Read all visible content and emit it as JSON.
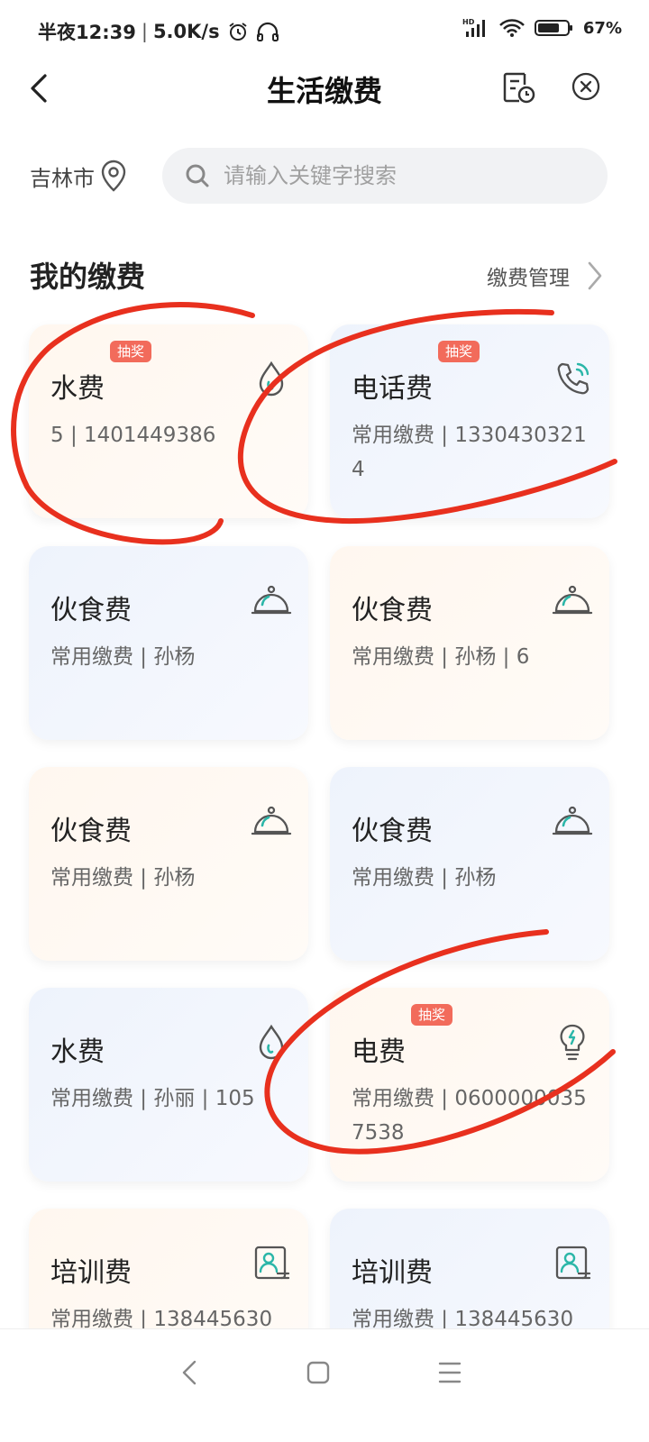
{
  "status_bar": {
    "time": "半夜12:39",
    "speed": "5.0K/s",
    "battery": "67%",
    "net_label": "HD",
    "icons": [
      "alarm-icon",
      "headphones-icon",
      "signal-icon",
      "wifi-icon",
      "battery-icon"
    ]
  },
  "header": {
    "title": "生活缴费",
    "icons": [
      "back-icon",
      "bill-record-icon",
      "close-icon"
    ]
  },
  "search": {
    "city": "吉林市",
    "placeholder": "请输入关键字搜索"
  },
  "section": {
    "title": "我的缴费",
    "manage_label": "缴费管理"
  },
  "cards": [
    {
      "title": "水费",
      "subtitle": "5 | 1401449386",
      "badge": "抽奖",
      "icon": "water-drop-icon"
    },
    {
      "title": "电话费",
      "subtitle": "常用缴费 | 13304303214",
      "badge": "抽奖",
      "icon": "phone-icon"
    },
    {
      "title": "伙食费",
      "subtitle": "常用缴费 | 孙杨",
      "badge": "",
      "icon": "food-cloche-icon"
    },
    {
      "title": "伙食费",
      "subtitle": "常用缴费 | 孙杨 | 6",
      "badge": "",
      "icon": "food-cloche-icon"
    },
    {
      "title": "伙食费",
      "subtitle": "常用缴费 | 孙杨",
      "badge": "",
      "icon": "food-cloche-icon"
    },
    {
      "title": "伙食费",
      "subtitle": "常用缴费 | 孙杨",
      "badge": "",
      "icon": "food-cloche-icon"
    },
    {
      "title": "水费",
      "subtitle": "常用缴费 | 孙丽 | 105",
      "badge": "",
      "icon": "water-drop-icon"
    },
    {
      "title": "电费",
      "subtitle": "常用缴费 | 06000000357538",
      "badge": "抽奖",
      "icon": "lightbulb-icon"
    },
    {
      "title": "培训费",
      "subtitle": "常用缴费 | 138445630",
      "badge": "",
      "icon": "trainee-card-icon"
    },
    {
      "title": "培训费",
      "subtitle": "常用缴费 | 138445630",
      "badge": "",
      "icon": "trainee-card-icon"
    }
  ],
  "colors": {
    "accent": "#2bb6a8",
    "badge": "#f26b5b",
    "annotation_red": "#e8301e"
  }
}
